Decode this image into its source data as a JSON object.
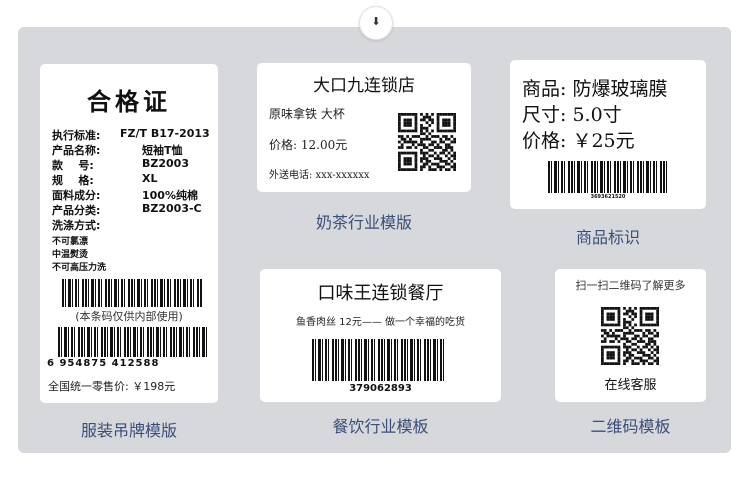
{
  "scroll_icon": "chevron-down-icon",
  "colors": {
    "panel_bg": "#d6d8dc",
    "caption": "#3a4f78",
    "card_bg": "#ffffff"
  },
  "templates": {
    "garment": {
      "caption": "服装吊牌模版",
      "title": "合格证",
      "fields": [
        {
          "label": "执行标准:",
          "value": "FZ/T B17-2013"
        },
        {
          "label": "产品名称:",
          "value": "短袖T恤"
        },
        {
          "label": "款    号:",
          "value": "BZ2003"
        },
        {
          "label": "规    格:",
          "value": "XL"
        },
        {
          "label": "面料成分:",
          "value": "100%纯棉"
        },
        {
          "label": "产品分类:",
          "value": "BZ2003-C"
        },
        {
          "label": "洗涤方式:",
          "value": ""
        }
      ],
      "wash": [
        "不可氯漂",
        "中温熨烫",
        "不可高压力洗"
      ],
      "barcode_note": "(本条码仅供内部使用)",
      "barcode_digits": "6 954875 412588",
      "price": "全国统一零售价: ￥198元"
    },
    "milk_tea": {
      "caption": "奶茶行业模版",
      "store": "大口九连锁店",
      "product": "原味拿铁   大杯",
      "price": "价格: 12.00元",
      "delivery": "外送电话: xxx-xxxxxx"
    },
    "product_label": {
      "caption": "商品标识",
      "line1": "商品: 防爆玻璃膜",
      "line2": "尺寸: 5.0寸",
      "line3": "价格: ￥25元",
      "barcode_number": "3693621520"
    },
    "restaurant": {
      "caption": "餐饮行业模板",
      "store": "口味王连锁餐厅",
      "slogan": "鱼香肉丝  12元—— 做一个幸福的吃货",
      "barcode_number": "379062893"
    },
    "qrcode": {
      "caption": "二维码模板",
      "hint": "扫一扫二维码了解更多",
      "label": "在线客服"
    }
  }
}
